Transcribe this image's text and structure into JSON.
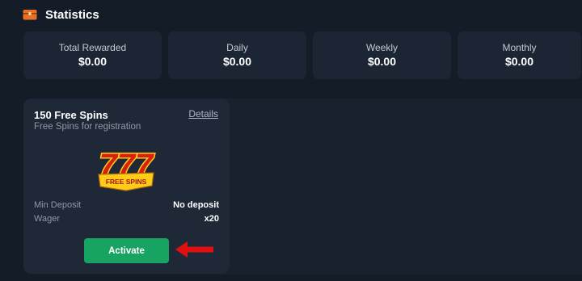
{
  "header": {
    "title": "Statistics",
    "icon": "chest-icon"
  },
  "stats": [
    {
      "label": "Total Rewarded",
      "value": "$0.00"
    },
    {
      "label": "Daily",
      "value": "$0.00"
    },
    {
      "label": "Weekly",
      "value": "$0.00"
    },
    {
      "label": "Monthly",
      "value": "$0.00"
    }
  ],
  "bonus": {
    "title": "150 Free Spins",
    "subtitle": "Free Spins for registration",
    "details_label": "Details",
    "logo_text": "777",
    "logo_banner": "FREE SPINS",
    "rows": [
      {
        "label": "Min Deposit",
        "value": "No deposit"
      },
      {
        "label": "Wager",
        "value": "x20"
      }
    ],
    "activate_label": "Activate"
  },
  "colors": {
    "background": "#141c27",
    "card": "#1b2533",
    "accent_green": "#17a463",
    "arrow_red": "#e01010"
  }
}
